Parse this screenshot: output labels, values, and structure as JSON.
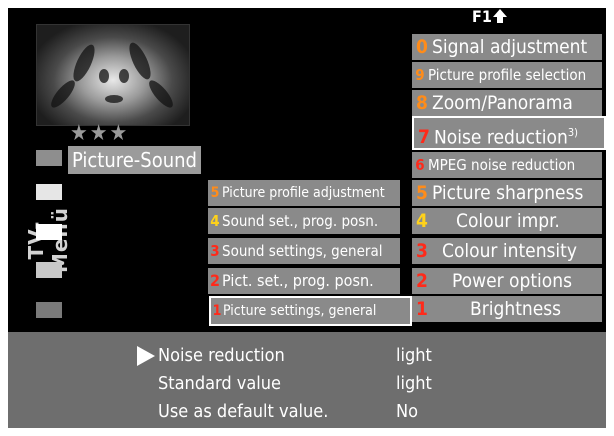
{
  "header": {
    "f1_label": "F1"
  },
  "left_panel": {
    "title": "TV-Menü",
    "rating": "★★★",
    "category_label": "Picture-Sound",
    "category_swatches": [
      "#8e8e8e",
      "#e6e6e6",
      "#ffffff",
      "#c8c8c8",
      "#7a7a7a"
    ]
  },
  "middle_menu": [
    {
      "num": "5",
      "label": "Picture profile adjustment"
    },
    {
      "num": "4",
      "label": "Sound set., prog. posn."
    },
    {
      "num": "3",
      "label": "Sound settings, general"
    },
    {
      "num": "2",
      "label": "Pict. set., prog. posn."
    },
    {
      "num": "1",
      "label": "Picture settings, general"
    }
  ],
  "right_menu": [
    {
      "num": "0",
      "label": "Signal adjustment"
    },
    {
      "num": "9",
      "label": "Picture profile selection"
    },
    {
      "num": "8",
      "label": "Zoom/Panorama"
    },
    {
      "num": "7",
      "label": "Noise reduction",
      "sup": "3)"
    },
    {
      "num": "6",
      "label": "MPEG noise reduction"
    },
    {
      "num": "5",
      "label": "Picture sharpness"
    },
    {
      "num": "4",
      "label": "Colour impr."
    },
    {
      "num": "3",
      "label": "Colour intensity"
    },
    {
      "num": "2",
      "label": "Power options"
    },
    {
      "num": "1",
      "label": "Brightness"
    }
  ],
  "settings": [
    {
      "label": "Noise reduction",
      "value": "light"
    },
    {
      "label": "Standard value",
      "value": "light"
    },
    {
      "label": "Use as default value.",
      "value": "No"
    }
  ],
  "colors": {
    "menu_item_bg": "#8a8a8a",
    "panel_bg": "#6e6e6e",
    "number_orange": "#ff8c1a",
    "number_yellow": "#ffd21a",
    "number_red": "#ff2a1a"
  }
}
